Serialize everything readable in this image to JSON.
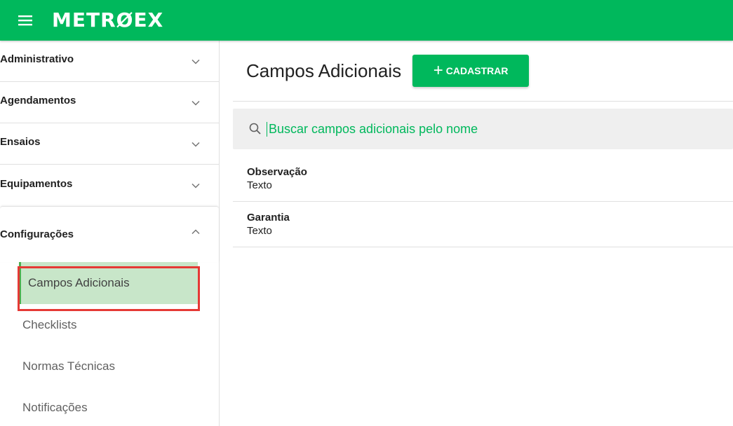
{
  "app": {
    "logo_text": "METRØEX"
  },
  "sidebar": {
    "sections": [
      {
        "label": "Administrativo"
      },
      {
        "label": "Agendamentos"
      },
      {
        "label": "Ensaios"
      },
      {
        "label": "Equipamentos"
      },
      {
        "label": "Configurações"
      }
    ],
    "config_items": [
      {
        "label": "Campos Adicionais"
      },
      {
        "label": "Checklists"
      },
      {
        "label": "Normas Técnicas"
      },
      {
        "label": "Notificações"
      }
    ]
  },
  "main": {
    "title": "Campos Adicionais",
    "add_button_label": "CADASTRAR",
    "search_placeholder": "Buscar campos adicionais pelo nome",
    "rows": [
      {
        "name": "Observação",
        "type": "Texto"
      },
      {
        "name": "Garantia",
        "type": "Texto"
      }
    ]
  },
  "colors": {
    "brand": "#00b85c",
    "active_bg": "#c8e6c9",
    "highlight": "#e53935"
  }
}
